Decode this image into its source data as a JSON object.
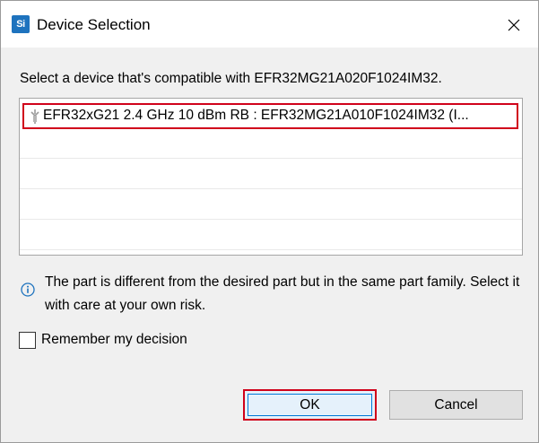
{
  "window": {
    "app_icon_text": "Si",
    "title": "Device Selection",
    "close_icon": "close-icon"
  },
  "prompt": "Select a device that's compatible with EFR32MG21A020F1024IM32.",
  "devices": [
    {
      "label": "EFR32xG21 2.4 GHz 10 dBm RB : EFR32MG21A010F1024IM32 (I...",
      "selected": true,
      "icon": "chip-icon"
    }
  ],
  "info": {
    "icon": "info-icon",
    "text": "The part is different from the desired part but in the same part family. Select it with care at your own risk."
  },
  "remember": {
    "label": "Remember my decision",
    "checked": false
  },
  "buttons": {
    "ok": "OK",
    "cancel": "Cancel"
  },
  "colors": {
    "highlight_border": "#d0021b",
    "app_icon_bg": "#1e73be",
    "info_icon": "#1e73be"
  }
}
